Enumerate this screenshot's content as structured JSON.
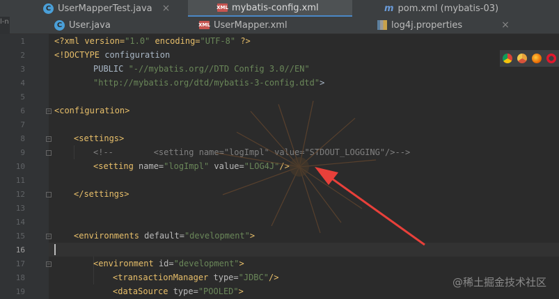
{
  "tabs_top": [
    {
      "label": "UserMapperTest.java",
      "icon": "java-class-icon"
    },
    {
      "label": "mybatis-config.xml",
      "icon": "xml-file-icon",
      "active": true
    },
    {
      "label": "pom.xml (mybatis-03)",
      "icon": "maven-icon"
    }
  ],
  "tabs_second": [
    {
      "label": "User.java",
      "icon": "java-class-icon"
    },
    {
      "label": "UserMapper.xml",
      "icon": "xml-file-icon"
    },
    {
      "label": "log4j.properties",
      "icon": "properties-file-icon"
    }
  ],
  "left_panel_fragment": "l-n",
  "line_numbers": [
    "1",
    "2",
    "3",
    "4",
    "5",
    "6",
    "7",
    "8",
    "9",
    "10",
    "11",
    "12",
    "13",
    "14",
    "15",
    "16",
    "17",
    "18",
    "19"
  ],
  "current_line": 16,
  "code": {
    "l1_a": "<?xml version=",
    "l1_b": "\"1.0\"",
    " l1_c": "",
    "l1_d": " encoding=",
    "l1_e": "\"UTF-8\"",
    "l1_f": " ?>",
    "l2_a": "<!DOCTYPE ",
    "l2_b": "configuration",
    "l3_a": "PUBLIC ",
    "l3_b": "\"-//mybatis.org//DTD Config 3.0//EN\"",
    "l4_a": "\"http://mybatis.org/dtd/mybatis-3-config.dtd\"",
    "l4_b": ">",
    "l6": "<configuration>",
    "l8": "<settings>",
    "l9_a": "<!--        <setting name=",
    "l9_b": "\"logImpl\"",
    "l9_c": " value=",
    "l9_d": "\"STDOUT_LOGGING\"",
    "l9_e": "/>-->",
    "l10_a": "<setting ",
    "l10_b": "name=",
    "l10_c": "\"logImpl\"",
    "l10_d": " value=",
    "l10_e": "\"LOG4J\"",
    "l10_f": "/>",
    "l12": "</settings>",
    "l15_a": "<environments ",
    "l15_b": "default=",
    "l15_c": "\"development\"",
    "l15_d": ">",
    "l17_a": "<environment ",
    "l17_b": "id=",
    "l17_c": "\"development\"",
    "l17_d": ">",
    "l18_a": "<transactionManager ",
    "l18_b": "type=",
    "l18_c": "\"JDBC\"",
    "l18_d": "/>",
    "l19_a": "<dataSource ",
    "l19_b": "type=",
    "l19_c": "\"POOLED\"",
    "l19_d": ">"
  },
  "browser_icons": [
    "chrome-icon",
    "chrome-canary-icon",
    "firefox-icon",
    "opera-icon"
  ],
  "watermark": "@稀土掘金技术社区",
  "colors": {
    "accent_tab": "#4a88c7",
    "tag": "#e8bf6a",
    "string": "#6a8759",
    "arrow": "#e8403a"
  }
}
